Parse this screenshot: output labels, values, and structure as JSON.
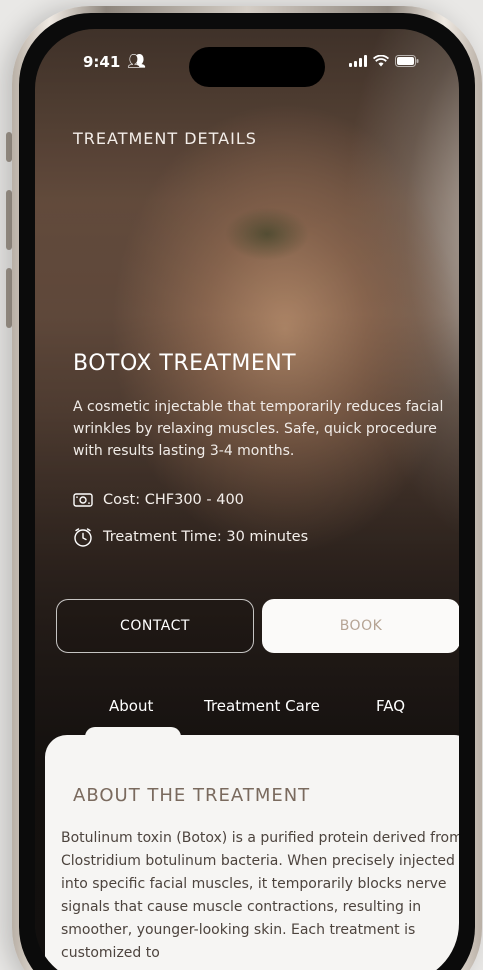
{
  "status_bar": {
    "time": "9:41",
    "people_icon": "people-icon",
    "signal_icon": "signal-icon",
    "wifi_icon": "wifi-icon",
    "battery_icon": "battery-icon"
  },
  "header": {
    "eyebrow": "TREATMENT DETAILS"
  },
  "treatment": {
    "title": "BOTOX TREATMENT",
    "description": "A cosmetic injectable that temporarily reduces facial wrinkles by relaxing muscles. Safe, quick procedure with results lasting 3-4 months.",
    "cost": "Cost: CHF300 - 400",
    "cost_icon": "money-icon",
    "time": "Treatment Time: 30 minutes",
    "time_icon": "clock-icon"
  },
  "actions": {
    "contact_label": "CONTACT",
    "book_label": "BOOK"
  },
  "tabs": [
    {
      "label": "About",
      "active": true
    },
    {
      "label": "Treatment Care",
      "active": false
    },
    {
      "label": "FAQ",
      "active": false
    }
  ],
  "about": {
    "heading": "ABOUT THE TREATMENT",
    "body": "Botulinum toxin (Botox) is a purified protein derived from Clostridium botulinum bacteria. When precisely injected into specific facial muscles, it temporarily blocks nerve signals that cause muscle contractions, resulting in smoother, younger-looking skin. Each treatment is customized to"
  },
  "colors": {
    "accent_text": "#b6a494",
    "panel_bg": "#f6f5f3",
    "heading": "#7a6a5e"
  }
}
